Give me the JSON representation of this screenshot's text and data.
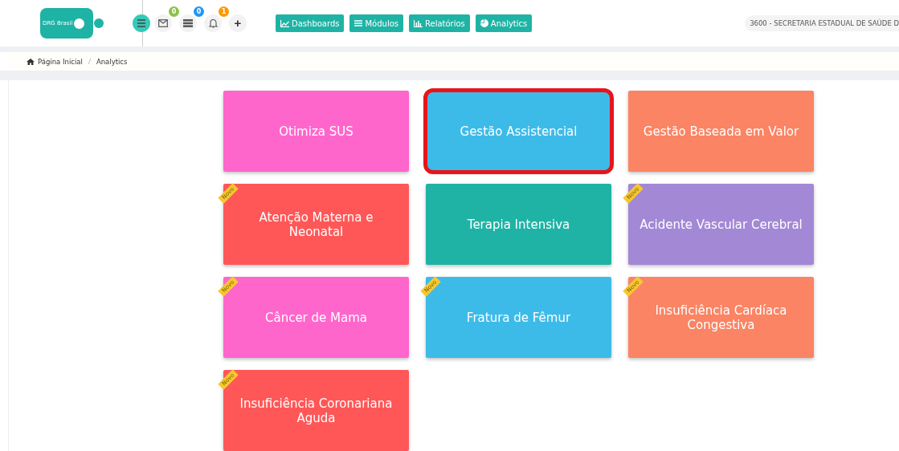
{
  "header": {
    "logo": "DRG Brasil",
    "badges": [
      {
        "kind": "mail",
        "count": "0",
        "color": "#8bc34a"
      },
      {
        "kind": "list",
        "count": "0",
        "color": "#2196f3"
      },
      {
        "kind": "bell",
        "count": "1",
        "color": "#ff9800"
      }
    ],
    "plus": "+",
    "nav": [
      {
        "kind": "chart",
        "label": "Dashboards"
      },
      {
        "kind": "menu",
        "label": "Módulos"
      },
      {
        "kind": "bars",
        "label": "Relatórios"
      },
      {
        "kind": "pie",
        "label": "Analytics"
      }
    ],
    "organization": "3600 - SECRETARIA ESTADUAL DE SAÚDE D"
  },
  "breadcrumb": [
    "Página Inicial",
    "Analytics"
  ],
  "cards": [
    {
      "title": "Otimiza SUS",
      "color": "#ff66cc",
      "highlighted": false
    },
    {
      "title": "Gestão Assistencial",
      "color": "#3dbbe8",
      "highlighted": true
    },
    {
      "title": "Gestão Baseada em Valor",
      "color": "#fa8464",
      "highlighted": false
    },
    {
      "title": "Atenção Materna e Neonatal",
      "color": "#ff5757",
      "badge": "Novo",
      "highlighted": false
    },
    {
      "title": "Terapia Intensiva",
      "color": "#1fb3a5",
      "highlighted": false
    },
    {
      "title": "Acidente Vascular Cerebral",
      "color": "#a388d5",
      "badge": "Novo",
      "highlighted": false
    },
    {
      "title": "Câncer de Mama",
      "color": "#ff66cc",
      "badge": "Novo",
      "highlighted": false
    },
    {
      "title": "Fratura de Fêmur",
      "color": "#3dbbe8",
      "badge": "Novo",
      "highlighted": false
    },
    {
      "title": "Insuficiência Cardíaca Congestiva",
      "color": "#fa8464",
      "badge": "Novo",
      "highlighted": false
    },
    {
      "title": "Insuficiência Coronariana Aguda",
      "color": "#ff5757",
      "badge": "Novo",
      "highlighted": false
    }
  ]
}
